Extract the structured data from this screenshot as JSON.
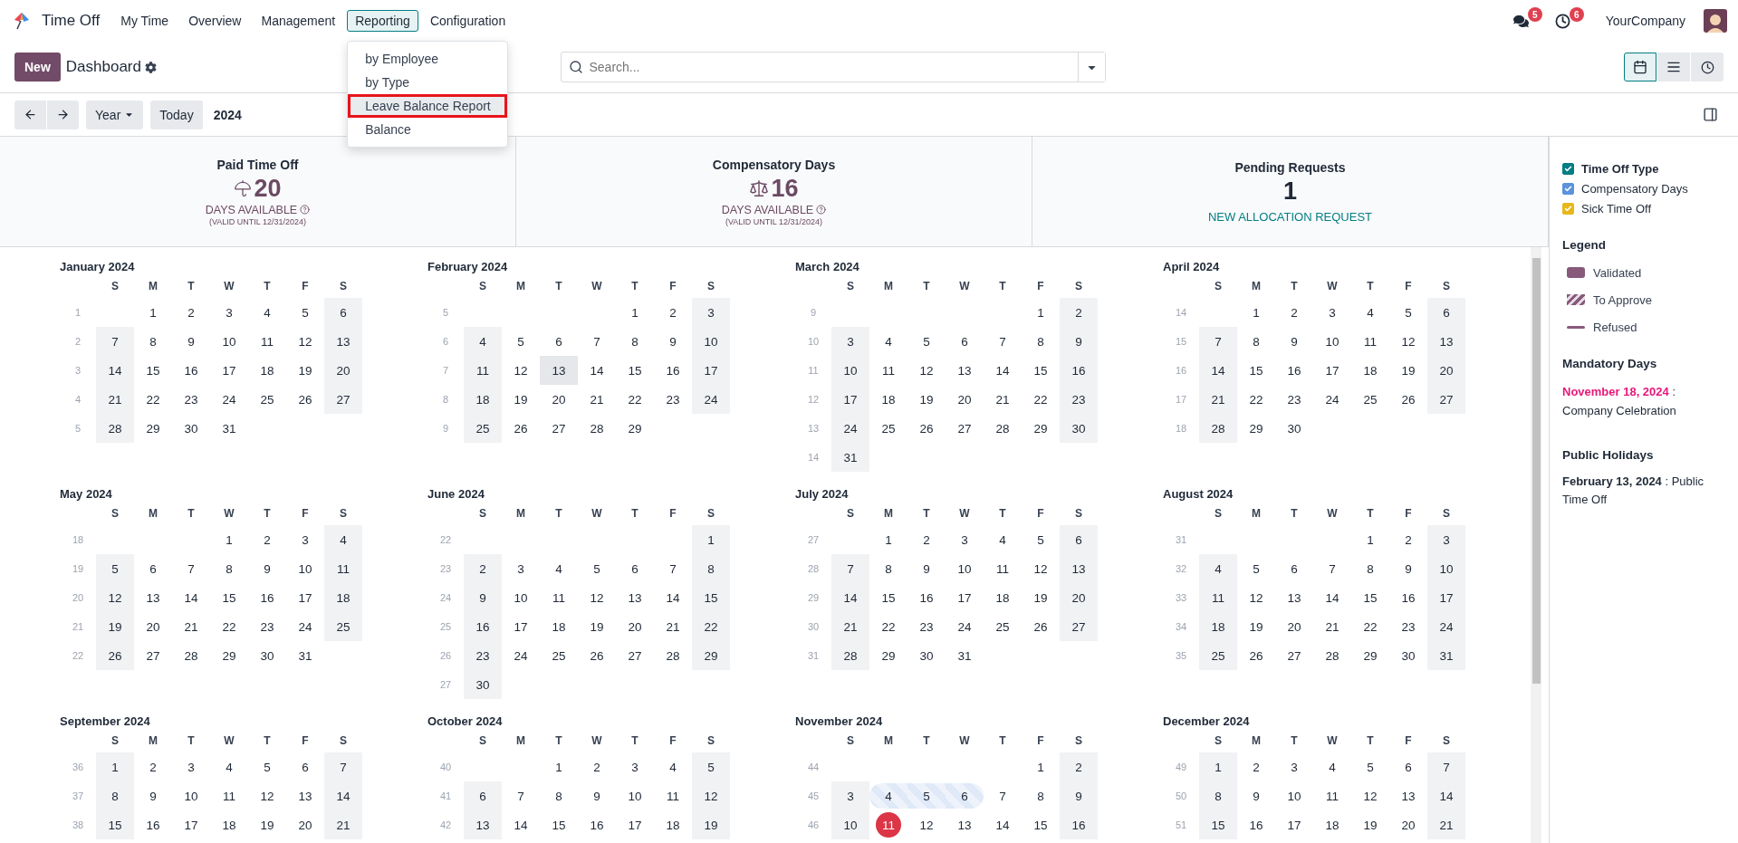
{
  "app": {
    "name": "Time Off"
  },
  "nav": [
    {
      "label": "My Time",
      "selected": false
    },
    {
      "label": "Overview",
      "selected": false
    },
    {
      "label": "Management",
      "selected": false
    },
    {
      "label": "Reporting",
      "selected": true
    },
    {
      "label": "Configuration",
      "selected": false
    }
  ],
  "menu": [
    {
      "label": "by Employee",
      "selected": false
    },
    {
      "label": "by Type",
      "selected": false
    },
    {
      "label": "Leave Balance Report",
      "selected": true
    },
    {
      "label": "Balance",
      "selected": false
    }
  ],
  "systray": {
    "messages_badge": "5",
    "activities_badge": "6",
    "company": "YourCompany"
  },
  "control_panel": {
    "new_button": "New",
    "title": "Dashboard",
    "search_placeholder": "Search...",
    "views": [
      {
        "kind": "calendar",
        "selected": true
      },
      {
        "kind": "list",
        "selected": false
      },
      {
        "kind": "activity",
        "selected": false
      }
    ],
    "scale": "Year",
    "today": "Today",
    "period": "2024"
  },
  "cards": [
    {
      "kind": "allocation",
      "title": "Paid Time Off",
      "value": "20",
      "label": "DAYS AVAILABLE",
      "note": "(VALID UNTIL 12/31/2024)"
    },
    {
      "kind": "allocation",
      "title": "Compensatory Days",
      "value": "16",
      "label": "DAYS AVAILABLE",
      "note": "(VALID UNTIL 12/31/2024)"
    },
    {
      "kind": "pending",
      "title": "Pending Requests",
      "value": "1",
      "link": "NEW ALLOCATION REQUEST"
    }
  ],
  "months": [
    {
      "title": "January 2024",
      "weekdays": [
        "S",
        "M",
        "T",
        "W",
        "T",
        "F",
        "S"
      ],
      "weeks": [
        {
          "kind": "start",
          "number": "1",
          "days": [
            "1",
            "2",
            "3",
            "4",
            "5",
            "6"
          ]
        },
        {
          "kind": "full",
          "number": "2",
          "days": [
            "7",
            "8",
            "9",
            "10",
            "11",
            "12",
            "13"
          ]
        },
        {
          "kind": "full",
          "number": "3",
          "days": [
            "14",
            "15",
            "16",
            "17",
            "18",
            "19",
            "20"
          ]
        },
        {
          "kind": "full",
          "number": "4",
          "days": [
            "21",
            "22",
            "23",
            "24",
            "25",
            "26",
            "27"
          ]
        },
        {
          "kind": "end",
          "number": "5",
          "days": [
            "28",
            "29",
            "30",
            "31"
          ]
        }
      ]
    },
    {
      "title": "February 2024",
      "weekdays": [
        "S",
        "M",
        "T",
        "W",
        "T",
        "F",
        "S"
      ],
      "weeks": [
        {
          "kind": "start",
          "number": "5",
          "days": [
            "1",
            "2",
            "3"
          ]
        },
        {
          "kind": "full",
          "number": "6",
          "days": [
            "4",
            "5",
            "6",
            "7",
            "8",
            "9",
            "10"
          ]
        },
        {
          "kind": "full",
          "number": "7",
          "days": [
            "11",
            "12",
            {
              "day": "13",
              "kind": "holiday"
            },
            "14",
            "15",
            "16",
            "17"
          ]
        },
        {
          "kind": "full",
          "number": "8",
          "days": [
            "18",
            "19",
            "20",
            "21",
            "22",
            "23",
            "24"
          ]
        },
        {
          "kind": "end",
          "number": "9",
          "days": [
            "25",
            "26",
            "27",
            "28",
            "29"
          ]
        }
      ]
    },
    {
      "title": "March 2024",
      "weekdays": [
        "S",
        "M",
        "T",
        "W",
        "T",
        "F",
        "S"
      ],
      "weeks": [
        {
          "kind": "start",
          "number": "9",
          "days": [
            "1",
            "2"
          ]
        },
        {
          "kind": "full",
          "number": "10",
          "days": [
            "3",
            "4",
            "5",
            "6",
            "7",
            "8",
            "9"
          ]
        },
        {
          "kind": "full",
          "number": "11",
          "days": [
            "10",
            "11",
            "12",
            "13",
            "14",
            "15",
            "16"
          ]
        },
        {
          "kind": "full",
          "number": "12",
          "days": [
            "17",
            "18",
            "19",
            "20",
            "21",
            "22",
            "23"
          ]
        },
        {
          "kind": "full",
          "number": "13",
          "days": [
            "24",
            "25",
            "26",
            "27",
            "28",
            "29",
            "30"
          ]
        },
        {
          "kind": "end",
          "number": "14",
          "days": [
            "31"
          ]
        }
      ]
    },
    {
      "title": "April 2024",
      "weekdays": [
        "S",
        "M",
        "T",
        "W",
        "T",
        "F",
        "S"
      ],
      "weeks": [
        {
          "kind": "start",
          "number": "14",
          "days": [
            "1",
            "2",
            "3",
            "4",
            "5",
            "6"
          ]
        },
        {
          "kind": "full",
          "number": "15",
          "days": [
            "7",
            "8",
            "9",
            "10",
            "11",
            "12",
            "13"
          ]
        },
        {
          "kind": "full",
          "number": "16",
          "days": [
            "14",
            "15",
            "16",
            "17",
            "18",
            "19",
            "20"
          ]
        },
        {
          "kind": "full",
          "number": "17",
          "days": [
            "21",
            "22",
            "23",
            "24",
            "25",
            "26",
            "27"
          ]
        },
        {
          "kind": "end",
          "number": "18",
          "days": [
            "28",
            "29",
            "30"
          ]
        }
      ]
    },
    {
      "title": "May 2024",
      "weekdays": [
        "S",
        "M",
        "T",
        "W",
        "T",
        "F",
        "S"
      ],
      "weeks": [
        {
          "kind": "start",
          "number": "18",
          "days": [
            "1",
            "2",
            "3",
            "4"
          ]
        },
        {
          "kind": "full",
          "number": "19",
          "days": [
            "5",
            "6",
            "7",
            "8",
            "9",
            "10",
            "11"
          ]
        },
        {
          "kind": "full",
          "number": "20",
          "days": [
            "12",
            "13",
            "14",
            "15",
            "16",
            "17",
            "18"
          ]
        },
        {
          "kind": "full",
          "number": "21",
          "days": [
            "19",
            "20",
            "21",
            "22",
            "23",
            "24",
            "25"
          ]
        },
        {
          "kind": "end",
          "number": "22",
          "days": [
            "26",
            "27",
            "28",
            "29",
            "30",
            "31"
          ]
        }
      ]
    },
    {
      "title": "June 2024",
      "weekdays": [
        "S",
        "M",
        "T",
        "W",
        "T",
        "F",
        "S"
      ],
      "weeks": [
        {
          "kind": "start",
          "number": "22",
          "days": [
            "1"
          ]
        },
        {
          "kind": "full",
          "number": "23",
          "days": [
            "2",
            "3",
            "4",
            "5",
            "6",
            "7",
            "8"
          ]
        },
        {
          "kind": "full",
          "number": "24",
          "days": [
            "9",
            "10",
            "11",
            "12",
            "13",
            "14",
            "15"
          ]
        },
        {
          "kind": "full",
          "number": "25",
          "days": [
            "16",
            "17",
            "18",
            "19",
            "20",
            "21",
            "22"
          ]
        },
        {
          "kind": "full",
          "number": "26",
          "days": [
            "23",
            "24",
            "25",
            "26",
            "27",
            "28",
            "29"
          ]
        },
        {
          "kind": "end",
          "number": "27",
          "days": [
            "30"
          ]
        }
      ]
    },
    {
      "title": "July 2024",
      "weekdays": [
        "S",
        "M",
        "T",
        "W",
        "T",
        "F",
        "S"
      ],
      "weeks": [
        {
          "kind": "start",
          "number": "27",
          "days": [
            "1",
            "2",
            "3",
            "4",
            "5",
            "6"
          ]
        },
        {
          "kind": "full",
          "number": "28",
          "days": [
            "7",
            "8",
            "9",
            "10",
            "11",
            "12",
            "13"
          ]
        },
        {
          "kind": "full",
          "number": "29",
          "days": [
            "14",
            "15",
            "16",
            "17",
            "18",
            "19",
            "20"
          ]
        },
        {
          "kind": "full",
          "number": "30",
          "days": [
            "21",
            "22",
            "23",
            "24",
            "25",
            "26",
            "27"
          ]
        },
        {
          "kind": "end",
          "number": "31",
          "days": [
            "28",
            "29",
            "30",
            "31"
          ]
        }
      ]
    },
    {
      "title": "August 2024",
      "weekdays": [
        "S",
        "M",
        "T",
        "W",
        "T",
        "F",
        "S"
      ],
      "weeks": [
        {
          "kind": "start",
          "number": "31",
          "days": [
            "1",
            "2",
            "3"
          ]
        },
        {
          "kind": "full",
          "number": "32",
          "days": [
            "4",
            "5",
            "6",
            "7",
            "8",
            "9",
            "10"
          ]
        },
        {
          "kind": "full",
          "number": "33",
          "days": [
            "11",
            "12",
            "13",
            "14",
            "15",
            "16",
            "17"
          ]
        },
        {
          "kind": "full",
          "number": "34",
          "days": [
            "18",
            "19",
            "20",
            "21",
            "22",
            "23",
            "24"
          ]
        },
        {
          "kind": "full",
          "number": "35",
          "days": [
            "25",
            "26",
            "27",
            "28",
            "29",
            "30",
            "31"
          ]
        }
      ]
    },
    {
      "title": "September 2024",
      "weekdays": [
        "S",
        "M",
        "T",
        "W",
        "T",
        "F",
        "S"
      ],
      "weeks": [
        {
          "kind": "full",
          "number": "36",
          "days": [
            "1",
            "2",
            "3",
            "4",
            "5",
            "6",
            "7"
          ]
        },
        {
          "kind": "full",
          "number": "37",
          "days": [
            "8",
            "9",
            "10",
            "11",
            "12",
            "13",
            "14"
          ]
        },
        {
          "kind": "full",
          "number": "38",
          "days": [
            "15",
            "16",
            "17",
            "18",
            "19",
            "20",
            "21"
          ]
        }
      ]
    },
    {
      "title": "October 2024",
      "weekdays": [
        "S",
        "M",
        "T",
        "W",
        "T",
        "F",
        "S"
      ],
      "weeks": [
        {
          "kind": "start",
          "number": "40",
          "days": [
            "1",
            "2",
            "3",
            "4",
            "5"
          ]
        },
        {
          "kind": "full",
          "number": "41",
          "days": [
            "6",
            "7",
            "8",
            "9",
            "10",
            "11",
            "12"
          ]
        },
        {
          "kind": "full",
          "number": "42",
          "days": [
            "13",
            "14",
            "15",
            "16",
            "17",
            "18",
            "19"
          ]
        }
      ]
    },
    {
      "title": "November 2024",
      "weekdays": [
        "S",
        "M",
        "T",
        "W",
        "T",
        "F",
        "S"
      ],
      "weeks": [
        {
          "kind": "start",
          "number": "44",
          "days": [
            "1",
            "2"
          ]
        },
        {
          "kind": "full",
          "number": "45",
          "days": [
            "3",
            {
              "day": "4",
              "kind": "to_approve"
            },
            {
              "day": "5",
              "kind": "to_approve"
            },
            {
              "day": "6",
              "kind": "to_approve"
            },
            "7",
            "8",
            "9"
          ]
        },
        {
          "kind": "full",
          "number": "46",
          "days": [
            "10",
            {
              "day": "11",
              "kind": "today"
            },
            "12",
            "13",
            "14",
            "15",
            "16"
          ]
        }
      ]
    },
    {
      "title": "December 2024",
      "weekdays": [
        "S",
        "M",
        "T",
        "W",
        "T",
        "F",
        "S"
      ],
      "weeks": [
        {
          "kind": "full",
          "number": "49",
          "days": [
            "1",
            "2",
            "3",
            "4",
            "5",
            "6",
            "7"
          ]
        },
        {
          "kind": "full",
          "number": "50",
          "days": [
            "8",
            "9",
            "10",
            "11",
            "12",
            "13",
            "14"
          ]
        },
        {
          "kind": "full",
          "number": "51",
          "days": [
            "15",
            "16",
            "17",
            "18",
            "19",
            "20",
            "21"
          ]
        }
      ]
    }
  ],
  "filters": [
    {
      "kind": "header",
      "label": "Time Off Type",
      "checked": true,
      "color": "#017e84"
    },
    {
      "kind": "item",
      "label": "Compensatory Days",
      "checked": true,
      "color": "#5b93dd"
    },
    {
      "kind": "item",
      "label": "Sick Time Off",
      "checked": true,
      "color": "#e8b71b"
    }
  ],
  "legend": {
    "title": "Legend",
    "items": [
      {
        "kind": "validated",
        "label": "Validated"
      },
      {
        "kind": "to_approve",
        "label": "To Approve"
      },
      {
        "kind": "refused",
        "label": "Refused"
      }
    ]
  },
  "mandatory_days": {
    "title": "Mandatory Days",
    "items": [
      {
        "date": "November 18, 2024",
        "text": " : Company Celebration"
      }
    ]
  },
  "public_holidays": {
    "title": "Public Holidays",
    "items": [
      "**February 13, 2024** : Public Time Off"
    ]
  }
}
